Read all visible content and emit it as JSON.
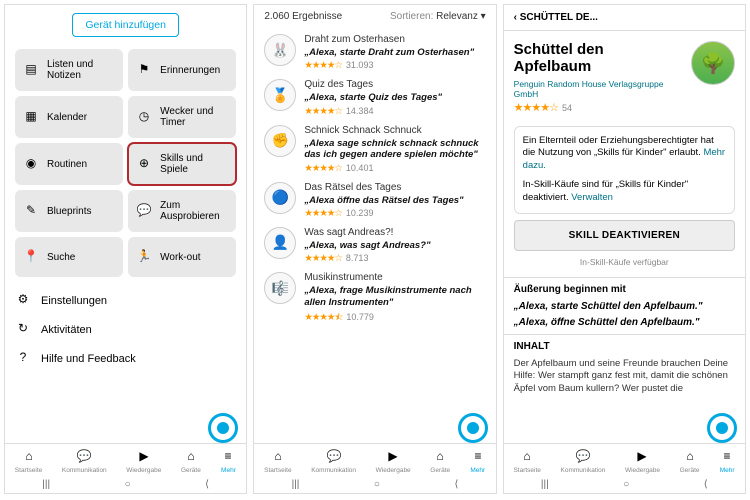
{
  "pane1": {
    "addDevice": "Gerät hinzufügen",
    "tiles": [
      {
        "name": "listen",
        "label": "Listen und Notizen",
        "icon": "list"
      },
      {
        "name": "erinnerungen",
        "label": "Erinnerungen",
        "icon": "flag"
      },
      {
        "name": "kalender",
        "label": "Kalender",
        "icon": "calendar"
      },
      {
        "name": "wecker",
        "label": "Wecker und Timer",
        "icon": "clock"
      },
      {
        "name": "routinen",
        "label": "Routinen",
        "icon": "routine"
      },
      {
        "name": "skills",
        "label": "Skills und Spiele",
        "icon": "gamepad",
        "highlight": true
      },
      {
        "name": "blueprints",
        "label": "Blueprints",
        "icon": "pencil"
      },
      {
        "name": "ausprobieren",
        "label": "Zum Ausprobieren",
        "icon": "chat"
      },
      {
        "name": "suche",
        "label": "Suche",
        "icon": "pin"
      },
      {
        "name": "workout",
        "label": "Work-out",
        "icon": "run"
      }
    ],
    "settings": [
      {
        "name": "einstellungen",
        "label": "Einstellungen",
        "icon": "gear"
      },
      {
        "name": "aktivitaeten",
        "label": "Aktivitäten",
        "icon": "history"
      },
      {
        "name": "hilfe",
        "label": "Hilfe und Feedback",
        "icon": "help"
      }
    ]
  },
  "pane2": {
    "count": "2.060 Ergebnisse",
    "sortLabel": "Sortieren:",
    "sortValue": "Relevanz",
    "skills": [
      {
        "name": "Draht zum Osterhasen",
        "phrase": "„Alexa, starte Draht zum Osterhasen\"",
        "stars": "★★★★☆",
        "count": "31.093",
        "emoji": "🐰"
      },
      {
        "name": "Quiz des Tages",
        "phrase": "„Alexa, starte Quiz des Tages\"",
        "stars": "★★★★☆",
        "count": "14.384",
        "emoji": "🏅"
      },
      {
        "name": "Schnick Schnack Schnuck",
        "phrase": "„Alexa sage schnick schnack schnuck das ich gegen andere spielen möchte\"",
        "stars": "★★★★☆",
        "count": "10.401",
        "emoji": "✊"
      },
      {
        "name": "Das Rätsel des Tages",
        "phrase": "„Alexa öffne das Rätsel des Tages\"",
        "stars": "★★★★☆",
        "count": "10.239",
        "emoji": "🔵"
      },
      {
        "name": "Was sagt Andreas?!",
        "phrase": "„Alexa, was sagt Andreas?\"",
        "stars": "★★★★☆",
        "count": "8.713",
        "emoji": "👤"
      },
      {
        "name": "Musikinstrumente",
        "phrase": "„Alexa, frage Musikinstrumente nach allen Instrumenten\"",
        "stars": "★★★★⯪",
        "count": "10.779",
        "emoji": "🎼"
      }
    ]
  },
  "pane3": {
    "crumb": "SCHÜTTEL DE...",
    "title": "Schüttel den Apfelbaum",
    "publisher": "Penguin Random House Verlagsgruppe GmbH",
    "stars": "★★★★☆",
    "rcount": "54",
    "notice1a": "Ein Elternteil oder Erziehungsberechtigter hat die Nutzung von „Skills für Kinder\" erlaubt. ",
    "notice1link": "Mehr dazu.",
    "notice2a": "In-Skill-Käufe sind für „Skills für Kinder\" deaktiviert. ",
    "notice2link": "Verwalten",
    "deactivate": "SKILL DEAKTIVIEREN",
    "iskAvail": "In-Skill-Käufe verfügbar",
    "utterHead": "Äußerung beginnen mit",
    "utter1": "„Alexa, starte Schüttel den Apfelbaum.\"",
    "utter2": "„Alexa, öffne Schüttel den Apfelbaum.\"",
    "contentHead": "INHALT",
    "desc": "Der Apfelbaum und seine Freunde brauchen Deine Hilfe: Wer stampft ganz fest mit, damit die schönen Äpfel vom Baum kullern? Wer pustet die"
  },
  "nav": [
    {
      "name": "startseite",
      "label": "Startseite",
      "icon": "home"
    },
    {
      "name": "kommunikation",
      "label": "Kommunikation",
      "icon": "chat"
    },
    {
      "name": "wiedergabe",
      "label": "Wiedergabe",
      "icon": "play"
    },
    {
      "name": "geraete",
      "label": "Geräte",
      "icon": "device"
    },
    {
      "name": "mehr",
      "label": "Mehr",
      "icon": "menu"
    }
  ]
}
